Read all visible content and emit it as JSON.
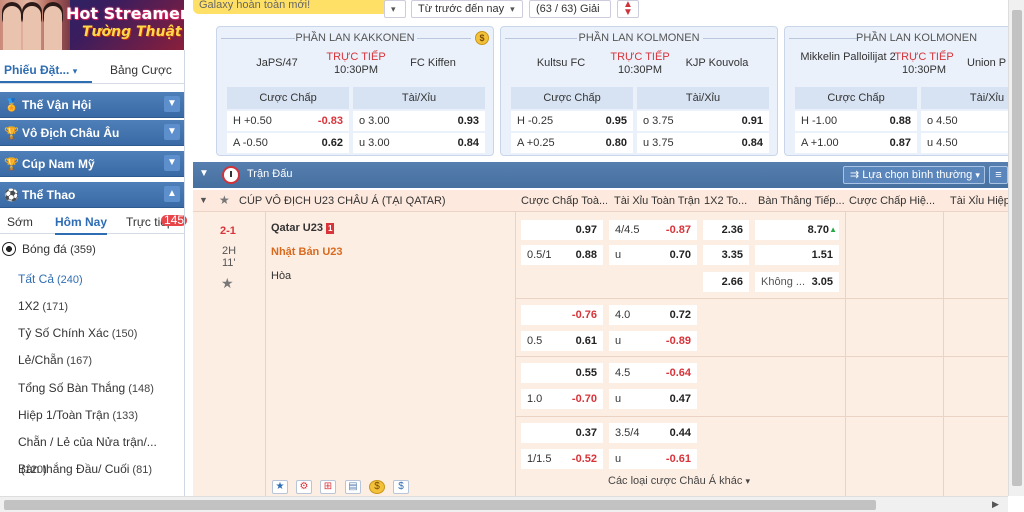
{
  "banner": {
    "line1": "Hot Streamer",
    "line2": "Tường Thuật"
  },
  "toolbar": {
    "notice": "Galaxy hoàn toàn mới!",
    "sort_select": "Từ trước đến nay",
    "count_select": "(63 / 63) Giải"
  },
  "sidebar": {
    "tab_ticket": "Phiếu Đặt...",
    "tab_odds": "Bảng Cược",
    "menus": [
      "Thế Vận Hội",
      "Vô Địch Châu Âu",
      "Cúp Nam Mỹ",
      "Thể Thao"
    ],
    "subtabs": {
      "early": "Sớm",
      "today": "Hôm Nay",
      "live": "Trực tiếp",
      "live_badge": "145"
    },
    "sport": {
      "name": "Bóng đá",
      "count": "(359)"
    },
    "items": [
      {
        "label": "Tất Cả",
        "count": "(240)"
      },
      {
        "label": "1X2",
        "count": "(171)"
      },
      {
        "label": "Tỷ Số Chính Xác",
        "count": "(150)"
      },
      {
        "label": "Lẻ/Chẵn",
        "count": "(167)"
      },
      {
        "label": "Tổng Số Bàn Thắng",
        "count": "(148)"
      },
      {
        "label": "Hiệp 1/Toàn Trận",
        "count": "(133)"
      },
      {
        "label": "Chẵn / Lẻ của Nửa trận/...",
        "count": "(120)"
      },
      {
        "label": "Bàn thắng Đầu/ Cuối",
        "count": "(81)"
      }
    ]
  },
  "cards": [
    {
      "league": "PHẦN LAN KAKKONEN",
      "home": "JaPS/47",
      "away": "FC Kiffen",
      "live": "TRỰC TIẾP",
      "time": "10:30PM",
      "hdr_hcp": "Cược Chấp",
      "hdr_ou": "Tài/Xỉu",
      "rows": [
        [
          "H +0.50",
          "-0.83",
          "o 3.00",
          "0.93"
        ],
        [
          "A -0.50",
          "0.62",
          "u 3.00",
          "0.84"
        ]
      ]
    },
    {
      "league": "PHẦN LAN KOLMONEN",
      "home": "Kultsu FC",
      "away": "KJP Kouvola",
      "live": "TRỰC TIẾP",
      "time": "10:30PM",
      "hdr_hcp": "Cược Chấp",
      "hdr_ou": "Tài/Xỉu",
      "rows": [
        [
          "H -0.25",
          "0.95",
          "o 3.75",
          "0.91"
        ],
        [
          "A +0.25",
          "0.80",
          "u 3.75",
          "0.84"
        ]
      ]
    },
    {
      "league": "PHẦN LAN KOLMONEN",
      "home": "Mikkelin Palloilijat 2",
      "away": "Union P",
      "live": "TRỰC TIẾP",
      "time": "10:30PM",
      "hdr_hcp": "Cược Chấp",
      "hdr_ou": "Tài/Xỉu",
      "rows": [
        [
          "H -1.00",
          "0.88",
          "o 4.50",
          ""
        ],
        [
          "A +1.00",
          "0.87",
          "u 4.50",
          ""
        ]
      ]
    }
  ],
  "main": {
    "title": "Trận Đấu",
    "filter": "Lựa chọn bình thường",
    "league": "CÚP VÔ ĐỊCH U23 CHÂU Á (TẠI QATAR)",
    "columns": [
      "Cược Chấp Toà...",
      "Tài Xỉu Toàn Trận",
      "1X2 To...",
      "Bàn Thắng Tiếp...",
      "Cược Chấp Hiệ...",
      "Tài Xỉu Hiệp"
    ],
    "match": {
      "score": "2-1",
      "period": "2H",
      "minute": "11'",
      "home": "Qatar U23",
      "home_red": "1",
      "away": "Nhật Bản U23",
      "draw": "Hòa"
    },
    "lines": [
      {
        "hcp_line": "0.5/1",
        "hcp_home": "0.97",
        "hcp_away": "0.88",
        "ou_line": "4/4.5",
        "ou_over": "-0.87",
        "ou_u": "u",
        "ou_under": "0.70"
      },
      {
        "hcp_line": "0.5",
        "hcp_home": "-0.76",
        "hcp_away": "0.61",
        "ou_line": "4.0",
        "ou_over": "0.72",
        "ou_u": "u",
        "ou_under": "-0.89"
      },
      {
        "hcp_line": "1.0",
        "hcp_home": "0.55",
        "hcp_away": "-0.70",
        "ou_line": "4.5",
        "ou_over": "-0.64",
        "ou_u": "u",
        "ou_under": "0.47"
      },
      {
        "hcp_line": "1/1.5",
        "hcp_home": "0.37",
        "hcp_away": "-0.52",
        "ou_line": "3.5/4",
        "ou_over": "0.44",
        "ou_u": "u",
        "ou_under": "-0.61"
      }
    ],
    "x12": [
      "2.36",
      "3.35",
      "2.66"
    ],
    "next_goal": {
      "home": "8.70",
      "away": "1.51",
      "none_label": "Không ...",
      "none": "3.05"
    },
    "more_link": "Các loại cược Châu Á khác"
  }
}
